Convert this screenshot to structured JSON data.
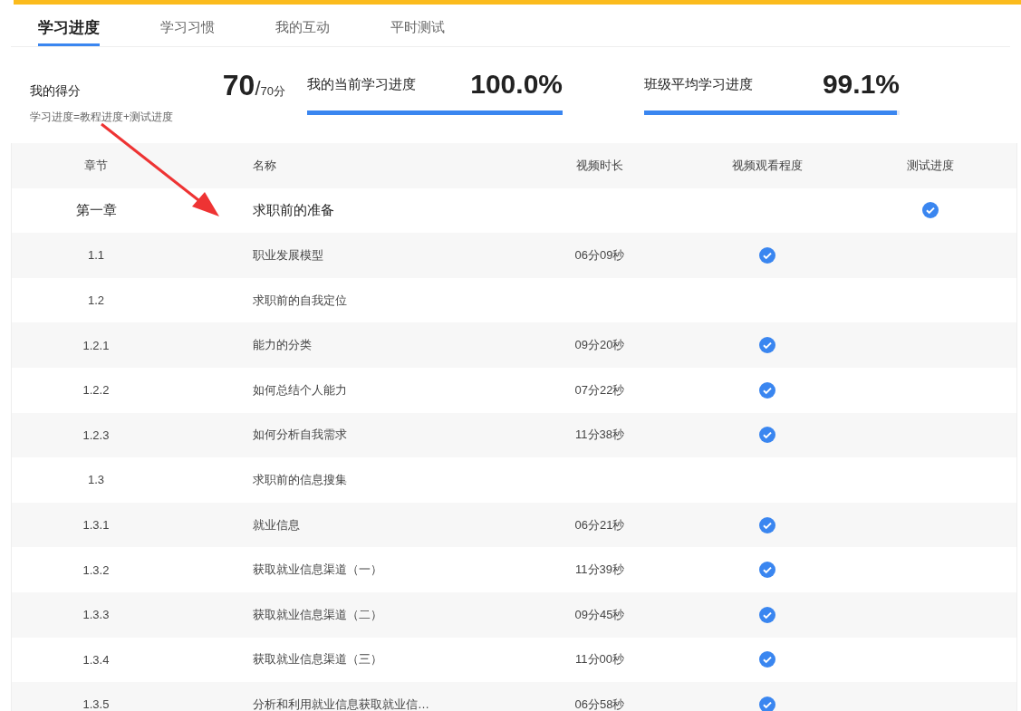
{
  "tabs": [
    {
      "label": "学习进度",
      "selected": true
    },
    {
      "label": "学习习惯",
      "selected": false
    },
    {
      "label": "我的互动",
      "selected": false
    },
    {
      "label": "平时测试",
      "selected": false
    }
  ],
  "score": {
    "label": "我的得分",
    "value": "70",
    "max": "/",
    "max_value": "70分",
    "formula": "学习进度=教程进度+测试进度"
  },
  "progress": [
    {
      "label": "我的当前学习进度",
      "value": "100.0%",
      "level": 1
    },
    {
      "label": "班级平均学习进度",
      "value": "99.1%",
      "level": 0.991
    }
  ],
  "table": {
    "columns": [
      "章节",
      "名称",
      "视频时长",
      "视频观看程度",
      "测试进度"
    ],
    "rows": [
      {
        "kind": "chapter",
        "section": "第一章",
        "name": "求职前的准备",
        "duration": "",
        "watched": false,
        "test_done": true
      },
      {
        "kind": "lesson",
        "section": "1.1",
        "name": "职业发展模型",
        "duration": "06分09秒",
        "watched": true,
        "test_done": false
      },
      {
        "kind": "lesson",
        "section": "1.2",
        "name": "求职前的自我定位",
        "duration": "",
        "watched": false,
        "test_done": false
      },
      {
        "kind": "lesson",
        "section": "1.2.1",
        "name": "能力的分类",
        "duration": "09分20秒",
        "watched": true,
        "test_done": false
      },
      {
        "kind": "lesson",
        "section": "1.2.2",
        "name": "如何总结个人能力",
        "duration": "07分22秒",
        "watched": true,
        "test_done": false
      },
      {
        "kind": "lesson",
        "section": "1.2.3",
        "name": "如何分析自我需求",
        "duration": "11分38秒",
        "watched": true,
        "test_done": false
      },
      {
        "kind": "lesson",
        "section": "1.3",
        "name": "求职前的信息搜集",
        "duration": "",
        "watched": false,
        "test_done": false
      },
      {
        "kind": "lesson",
        "section": "1.3.1",
        "name": "就业信息",
        "duration": "06分21秒",
        "watched": true,
        "test_done": false
      },
      {
        "kind": "lesson",
        "section": "1.3.2",
        "name": "获取就业信息渠道（一）",
        "duration": "11分39秒",
        "watched": true,
        "test_done": false
      },
      {
        "kind": "lesson",
        "section": "1.3.3",
        "name": "获取就业信息渠道（二）",
        "duration": "09分45秒",
        "watched": true,
        "test_done": false
      },
      {
        "kind": "lesson",
        "section": "1.3.4",
        "name": "获取就业信息渠道（三）",
        "duration": "11分00秒",
        "watched": true,
        "test_done": false
      },
      {
        "kind": "lesson",
        "section": "1.3.5",
        "name": "分析和利用就业信息获取就业信…",
        "duration": "06分58秒",
        "watched": true,
        "test_done": false
      }
    ]
  }
}
